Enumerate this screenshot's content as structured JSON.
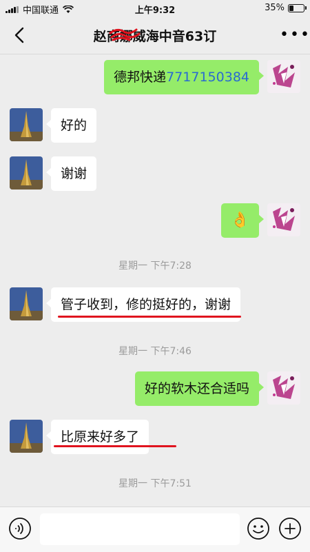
{
  "status_bar": {
    "carrier": "中国联通",
    "time": "上午9:32",
    "battery": "35%",
    "battery_level": 0.35
  },
  "header": {
    "title": "赵商娜威海中音63订"
  },
  "messages": [
    {
      "side": "out",
      "text": "德邦快递",
      "link": "7717150384"
    },
    {
      "side": "in",
      "text": "好的"
    },
    {
      "side": "in",
      "text": "谢谢"
    },
    {
      "side": "out",
      "emoji": "👌"
    },
    {
      "timestamp": "星期一 下午7:28"
    },
    {
      "side": "in",
      "text": "管子收到，修的挺好的，谢谢"
    },
    {
      "timestamp": "星期一 下午7:46"
    },
    {
      "side": "out",
      "text": "好的软木还合适吗"
    },
    {
      "side": "in",
      "text": "比原来好多了"
    },
    {
      "timestamp": "星期一 下午7:51"
    }
  ],
  "input_bar": {
    "voice_icon": "voice-icon",
    "emoji_icon": "emoji-icon",
    "plus_icon": "plus-icon"
  },
  "colors": {
    "bubble_out": "#95ec69",
    "bubble_in": "#ffffff",
    "link": "#2a6ad1",
    "annotation": "#e0131e"
  }
}
